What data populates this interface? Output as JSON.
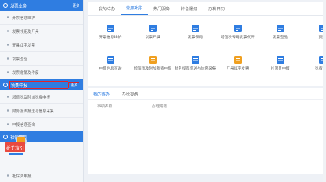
{
  "sidebar": {
    "sections": [
      {
        "title": "发票业务",
        "more": "更多",
        "items": [
          "开票信息维护",
          "发票领用及开具",
          "开具红字发票",
          "发票查验",
          "发票缴销及作废"
        ]
      },
      {
        "title": "税费申报",
        "more": "更多",
        "items": [
          "增值税及附加税费申报",
          "财务报表报送与信息采集",
          "申报信息查询"
        ]
      },
      {
        "title": "社保费用",
        "more": "",
        "items": [
          "社保费申报"
        ]
      }
    ],
    "promo_label": "新手指引"
  },
  "main": {
    "tabs": [
      "我的待办",
      "常用功能",
      "热门服务",
      "特色服务",
      "办税日历"
    ],
    "active_tab": 1,
    "functions": [
      {
        "label": "开票信息维护",
        "icon": "document-icon",
        "color": "#2f7de1"
      },
      {
        "label": "发票开具",
        "icon": "invoice-icon",
        "color": "#2f7de1"
      },
      {
        "label": "发票领用",
        "icon": "card-icon",
        "color": "#2f7de1"
      },
      {
        "label": "增值税专用发票代开",
        "icon": "receipt-icon",
        "color": "#2f7de1"
      },
      {
        "label": "发票查验",
        "icon": "copy-icon",
        "color": "#2f7de1"
      },
      {
        "label": "更多",
        "icon": "more-icon",
        "color": "#2f7de1"
      },
      {
        "label": "申报信息查询",
        "icon": "report-icon",
        "color": "#2f7de1"
      },
      {
        "label": "增值税及附加税费申报",
        "icon": "tax-icon",
        "color": "#f0a020"
      },
      {
        "label": "财务报表报送与信息采集",
        "icon": "wallet-icon",
        "color": "#2f7de1"
      },
      {
        "label": "开具红字发票",
        "icon": "money-icon",
        "color": "#f0a020"
      },
      {
        "label": "社保费申报",
        "icon": "checklist-icon",
        "color": "#2f7de1"
      },
      {
        "label": "税费缴纳",
        "icon": "more-icon",
        "color": "#2f7de1"
      }
    ]
  },
  "panel2": {
    "tabs": [
      "我的待办",
      "办税提醒"
    ],
    "columns": [
      "事项名称",
      "办理期限"
    ]
  }
}
